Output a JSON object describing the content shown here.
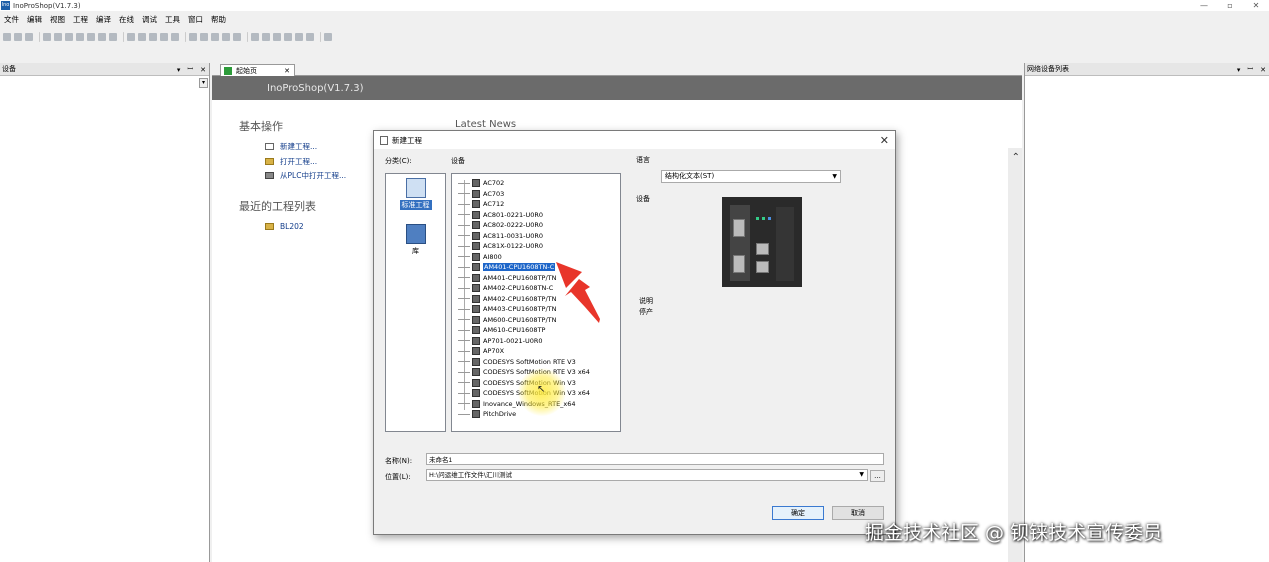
{
  "window": {
    "title": "InoProShop(V1.7.3)",
    "app_icon": "Ino"
  },
  "menu": [
    "文件",
    "编辑",
    "视图",
    "工程",
    "编译",
    "在线",
    "调试",
    "工具",
    "窗口",
    "帮助"
  ],
  "left_panel": {
    "title": "设备"
  },
  "right_panel": {
    "title": "网络设备列表"
  },
  "doc_tab": {
    "label": "起始页"
  },
  "start_page": {
    "banner": "InoProShop(V1.7.3)",
    "basic_ops_title": "基本操作",
    "actions": [
      "新建工程...",
      "打开工程...",
      "从PLC中打开工程..."
    ],
    "recent_title": "最近的工程列表",
    "recent": [
      "BL202"
    ],
    "latest_news": "Latest News"
  },
  "dialog": {
    "title": "新建工程",
    "category_label": "分类(C):",
    "device_label": "设备",
    "language_label": "语言",
    "device_image_label": "设备",
    "desc_label": "说明",
    "desc_value": "停产",
    "categories": [
      {
        "label": "标准工程",
        "selected": true,
        "icon": "standard-project-icon"
      },
      {
        "label": "库",
        "selected": false,
        "icon": "library-icon"
      }
    ],
    "devices": [
      "AC702",
      "AC703",
      "AC712",
      "AC801-0221-U0R0",
      "AC802-0222-U0R0",
      "AC811-0031-U0R0",
      "AC81X-0122-U0R0",
      "AI800",
      "AM401-CPU1608TN-C",
      "AM401-CPU1608TP/TN",
      "AM402-CPU1608TN-C",
      "AM402-CPU1608TP/TN",
      "AM403-CPU1608TP/TN",
      "AM600-CPU1608TP/TN",
      "AM610-CPU1608TP",
      "AP701-0021-U0R0",
      "AP70X",
      "CODESYS SoftMotion RTE V3",
      "CODESYS SoftMotion RTE V3 x64",
      "CODESYS SoftMotion Win V3",
      "CODESYS SoftMotion Win V3 x64",
      "Inovance_Windows_RTE_x64",
      "PitchDrive"
    ],
    "selected_device": "AM401-CPU1608TN-C",
    "language_value": "结构化文本(ST)",
    "name_label": "名称(N):",
    "name_value": "未命名1",
    "location_label": "位置(L):",
    "location_value": "H:\\问运维工作文件\\汇川测试",
    "browse": "...",
    "ok": "确定",
    "cancel": "取消"
  },
  "watermark": "掘金技术社区 @ 钡铼技术宣传委员",
  "colors": {
    "banner": "#6b6b6b",
    "selection": "#1e66c9",
    "arrow": "#e8352a",
    "highlight": "#ffeb3c"
  }
}
